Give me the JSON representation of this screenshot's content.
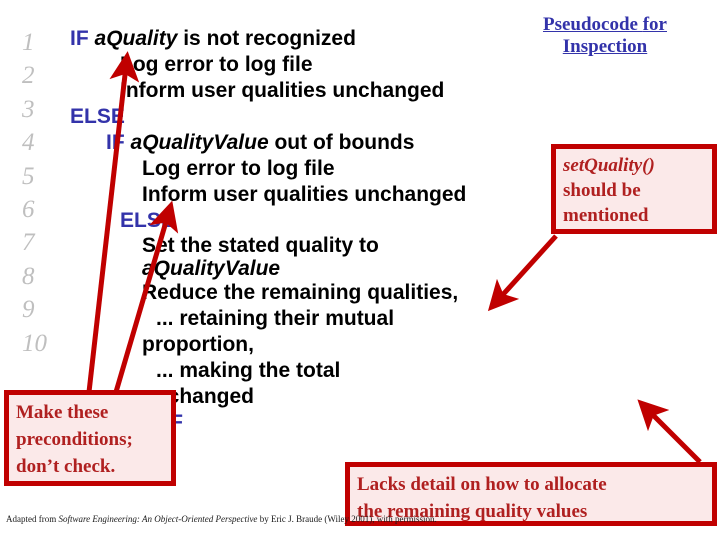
{
  "slide": {
    "title_line1": "Pseudocode",
    "title_line2": "for Inspection",
    "accent_blue": "#3333AA",
    "accent_red": "#C00000",
    "callout_text": "#B02020",
    "callout_fill": "#FBE9E9",
    "linenumber_color": "#BFBFBF"
  },
  "line_numbers": [
    "1",
    "2",
    "3",
    "4",
    "5",
    "6",
    "7",
    "8",
    "9",
    "10"
  ],
  "code_lines": [
    {
      "n": "1",
      "keyword": "IF",
      "var": "aQuality",
      "rest": " is not recognized"
    },
    {
      "n": "2",
      "keyword": "",
      "var": "",
      "rest": "Log error to log file"
    },
    {
      "n": "3",
      "keyword": "",
      "var": "",
      "rest": "Inform user qualities unchanged"
    },
    {
      "n": "4",
      "keyword": "ELSE",
      "var": "",
      "rest": ""
    },
    {
      "n": "5",
      "keyword": "IF",
      "var": "aQualityValue",
      "rest": " out of bounds"
    },
    {
      "n": "6",
      "keyword": "",
      "var": "",
      "rest": "Log error to log file"
    },
    {
      "n": "7",
      "keyword": "",
      "var": "",
      "rest": "Inform user qualities unchanged"
    },
    {
      "n": "8",
      "keyword": "ELSE",
      "var": "",
      "rest": ""
    },
    {
      "n": "9a",
      "keyword": "",
      "var": "",
      "rest": "Set the stated quality to"
    },
    {
      "n": "9b",
      "keyword": "",
      "var": "aQualityValue",
      "rest": ""
    },
    {
      "n": "10a",
      "keyword": "",
      "var": "",
      "rest": "Reduce the remaining qualities,"
    },
    {
      "n": "10b",
      "keyword": "",
      "var": "",
      "rest": "... retaining their mutual"
    },
    {
      "n": "10c",
      "keyword": "",
      "var": "",
      "rest": "proportion,"
    },
    {
      "n": "10d",
      "keyword": "",
      "var": "",
      "rest": "... making the total"
    },
    {
      "n": "10e",
      "keyword": "",
      "var": "",
      "rest": "unchanged"
    },
    {
      "n": "end",
      "keyword": "ENDIF",
      "var": "",
      "rest": ""
    }
  ],
  "callouts": {
    "setquality": {
      "line1": "setQuality()",
      "line2": "should be",
      "line3": "mentioned"
    },
    "preconditions": {
      "line1": "Make these",
      "line2": "preconditions;",
      "line3": "don’t check."
    },
    "lacksdetail": {
      "line1": "Lacks detail on how to allocate",
      "line2": "the remaining quality values"
    }
  },
  "attribution": {
    "prefix": "Adapted from ",
    "book": "Software Engineering: An Object-Oriented Perspective",
    "suffix": " by Eric J. Braude (Wiley 2001), with permission."
  }
}
